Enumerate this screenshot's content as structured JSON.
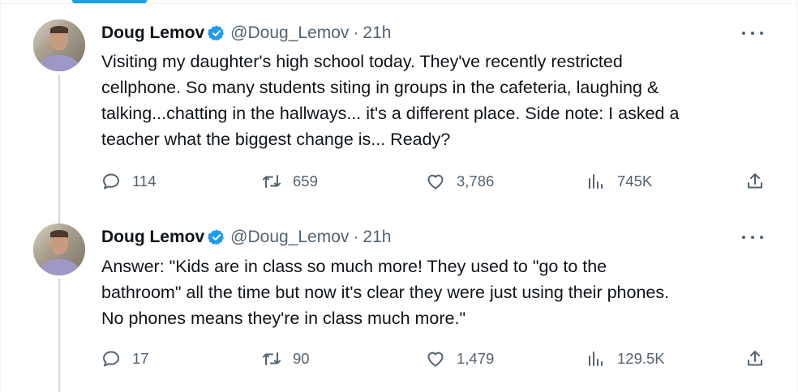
{
  "tweets": [
    {
      "author": "Doug Lemov",
      "handle": "@Doug_Lemov",
      "separator": "·",
      "time": "21h",
      "text": "Visiting my daughter's high school today. They've recently restricted\ncellphone. So many students siting in groups in the cafeteria, laughing &\ntalking...chatting in the hallways... it's a different place. Side note: I asked a\nteacher what the biggest change is... Ready?",
      "replies": "114",
      "reposts": "659",
      "likes": "3,786",
      "views": "745K"
    },
    {
      "author": "Doug Lemov",
      "handle": "@Doug_Lemov",
      "separator": "·",
      "time": "21h",
      "text": "Answer: \"Kids are in class so much more! They used to \"go to the\nbathroom\" all the time but now it's clear they were just using their phones.\nNo phones means they're in class much more.\"",
      "replies": "17",
      "reposts": "90",
      "likes": "1,479",
      "views": "129.5K"
    }
  ],
  "icons": {
    "verified": "verified-badge-icon",
    "more": "more-options-icon",
    "reply": "reply-icon",
    "repost": "repost-icon",
    "like": "heart-icon",
    "views": "views-chart-icon",
    "share": "share-icon"
  },
  "colors": {
    "accent": "#1d9bf0",
    "text": "#0f1419",
    "secondary": "#536471",
    "thread_line": "#cfd9de"
  }
}
